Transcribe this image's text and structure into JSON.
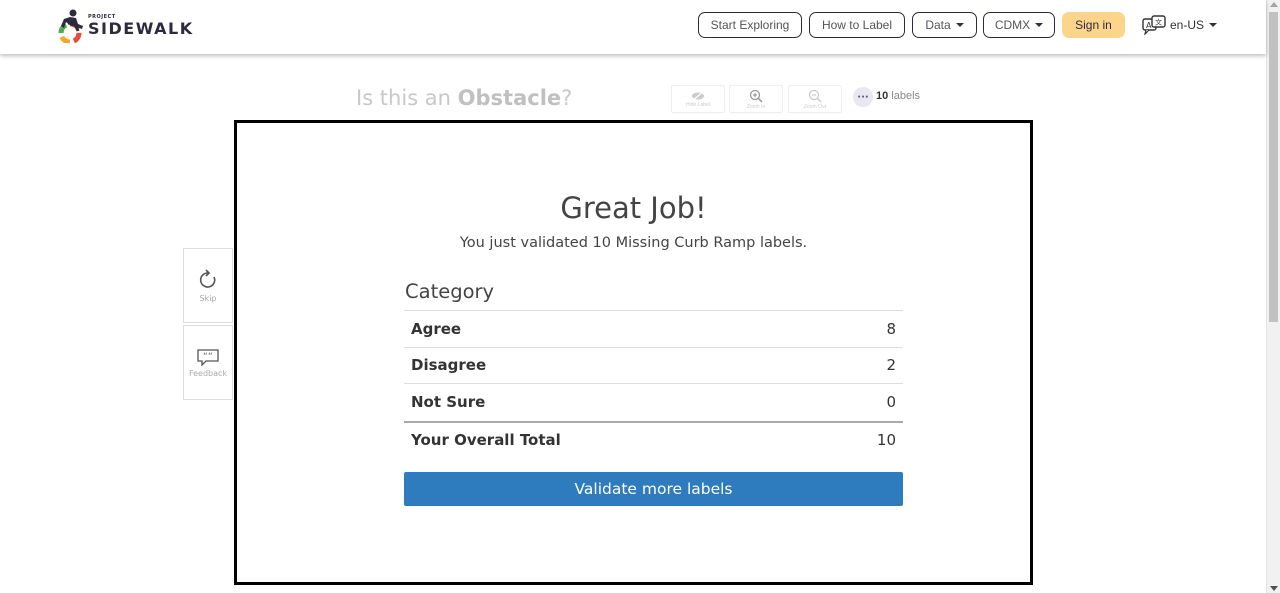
{
  "brand": {
    "small": "PROJECT",
    "big": "SIDEWALK"
  },
  "nav": {
    "start_exploring": "Start Exploring",
    "how_to_label": "How to Label",
    "data": "Data",
    "city": "CDMX",
    "sign_in": "Sign in",
    "language": "en-US"
  },
  "validate": {
    "question_prefix": "Is this an ",
    "question_label": "Obstacle",
    "question_suffix": "?",
    "tools": {
      "hide_label": "Hide Label",
      "zoom_in": "Zoom In",
      "zoom_out": "Zoom Out"
    },
    "labels_count": "10",
    "labels_word": "labels",
    "sidebar": {
      "skip": "Skip",
      "feedback": "Feedback"
    }
  },
  "modal": {
    "title": "Great Job!",
    "subtitle": "You just validated 10 Missing Curb Ramp labels.",
    "table_header": "Category",
    "rows": [
      {
        "name": "Agree",
        "value": "8"
      },
      {
        "name": "Disagree",
        "value": "2"
      },
      {
        "name": "Not Sure",
        "value": "0"
      }
    ],
    "total": {
      "name": "Your Overall Total",
      "value": "10"
    },
    "button": "Validate more labels"
  },
  "colors": {
    "brand_dark": "#2d2a3f",
    "sign_in_bg": "#fdd58a",
    "primary_button": "#2e7bbd"
  }
}
